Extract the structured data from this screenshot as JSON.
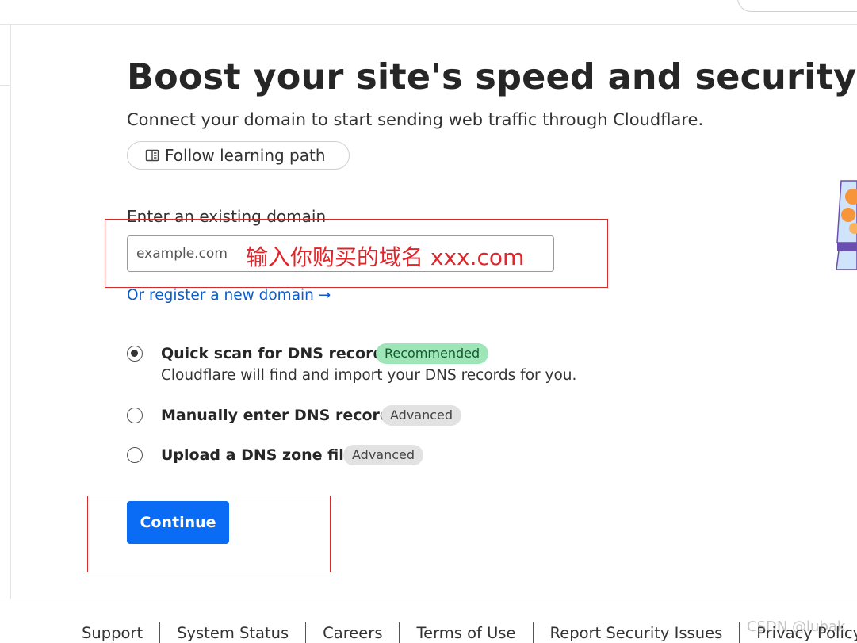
{
  "header": {
    "search_icon": "search-field-edge"
  },
  "page": {
    "title": "Boost your site's speed and security",
    "subtitle": "Connect your domain to start sending web traffic through Cloudflare.",
    "learning_path_label": "Follow learning path",
    "learning_path_icon": "book-icon"
  },
  "domain": {
    "label": "Enter an existing domain",
    "placeholder": "example.com",
    "value": "",
    "annotation": "输入你购买的域名   xxx.com",
    "register_link": "Or register a new domain →"
  },
  "options": [
    {
      "title": "Quick scan for DNS records",
      "badge": "Recommended",
      "description": "Cloudflare will find and import your DNS records for you.",
      "selected": true
    },
    {
      "title": "Manually enter DNS records",
      "badge": "Advanced",
      "selected": false
    },
    {
      "title": "Upload a DNS zone file",
      "badge": "Advanced",
      "selected": false
    }
  ],
  "continue_label": "Continue",
  "footer": {
    "links": [
      "Support",
      "System Status",
      "Careers",
      "Terms of Use",
      "Report Security Issues",
      "Privacy Policy"
    ]
  },
  "watermark": "CSDN @lubak",
  "colors": {
    "primary": "#0a6cf5",
    "link": "#0b5cc9",
    "annotation": "#e0262b",
    "recommended_bg": "#9ee6b8",
    "advanced_bg": "#e2e2e2"
  }
}
